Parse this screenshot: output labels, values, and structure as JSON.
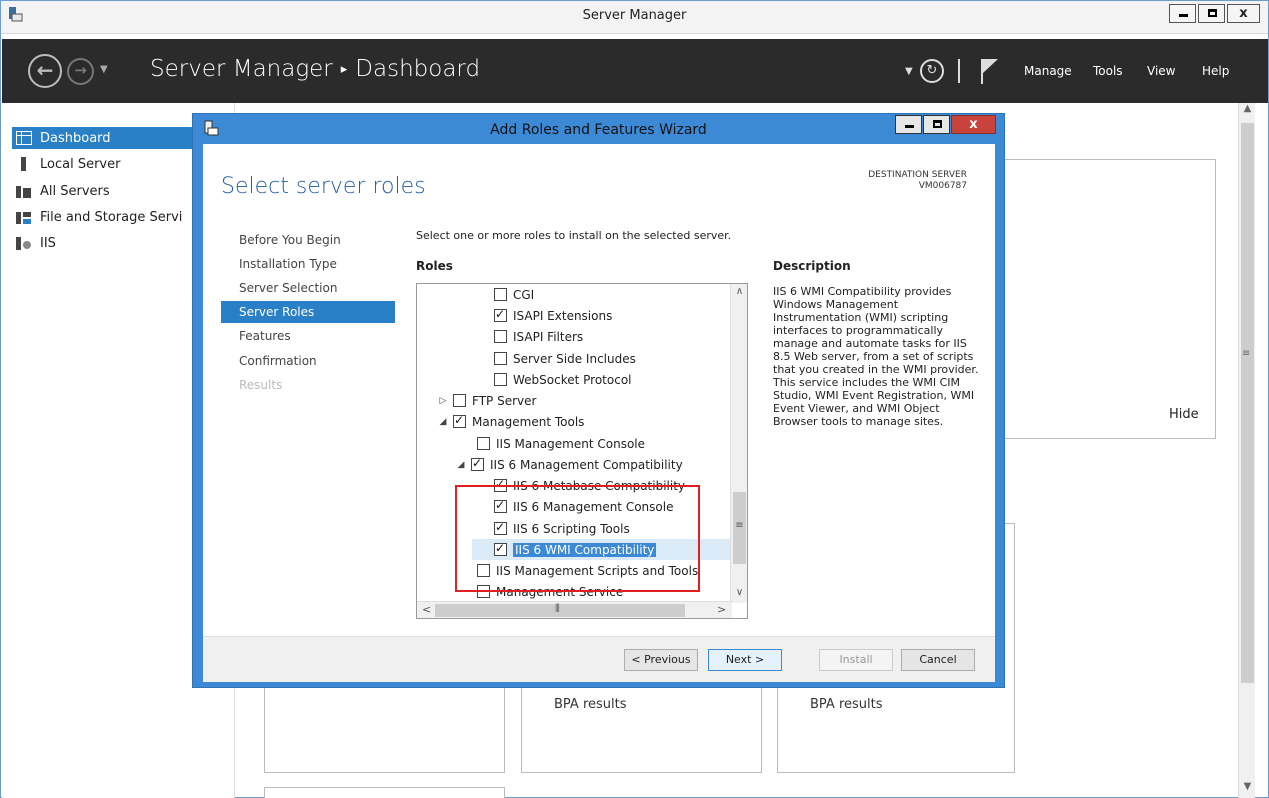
{
  "outer": {
    "title": "Server Manager",
    "minimize": "",
    "maximize": "",
    "close": "x"
  },
  "header": {
    "breadcrumb_app": "Server Manager",
    "breadcrumb_sep": "▸",
    "breadcrumb_page": "Dashboard",
    "menu": [
      "Manage",
      "Tools",
      "View",
      "Help"
    ]
  },
  "leftnav": {
    "items": [
      {
        "label": "Dashboard",
        "icon": "dashboard-icon"
      },
      {
        "label": "Local Server",
        "icon": "server-icon"
      },
      {
        "label": "All Servers",
        "icon": "servers-icon"
      },
      {
        "label": "File and Storage Servi",
        "icon": "storage-icon"
      },
      {
        "label": "IIS",
        "icon": "iis-icon"
      }
    ]
  },
  "background": {
    "hide_label": "Hide",
    "bpa1": "BPA results",
    "bpa2": "BPA results"
  },
  "wizard": {
    "title": "Add Roles and Features Wizard",
    "page_title": "Select server roles",
    "dest_label": "DESTINATION SERVER",
    "dest_server": "VM006787",
    "steps": [
      {
        "label": "Before You Begin",
        "state": "normal"
      },
      {
        "label": "Installation Type",
        "state": "normal"
      },
      {
        "label": "Server Selection",
        "state": "normal"
      },
      {
        "label": "Server Roles",
        "state": "active"
      },
      {
        "label": "Features",
        "state": "normal"
      },
      {
        "label": "Confirmation",
        "state": "normal"
      },
      {
        "label": "Results",
        "state": "disabled"
      }
    ],
    "intro": "Select one or more roles to install on the selected server.",
    "roles_heading": "Roles",
    "description_heading": "Description",
    "description": "IIS 6 WMI Compatibility provides Windows Management Instrumentation (WMI) scripting interfaces to programmatically manage and automate tasks for IIS 8.5 Web server, from a set of scripts that you created in the WMI provider. This service includes the WMI CIM Studio, WMI Event Registration, WMI Event Viewer, and WMI Object Browser tools to manage sites.",
    "tree": [
      {
        "label": "CGI",
        "checked": false,
        "expander": ""
      },
      {
        "label": "ISAPI Extensions",
        "checked": true,
        "expander": ""
      },
      {
        "label": "ISAPI Filters",
        "checked": false,
        "expander": ""
      },
      {
        "label": "Server Side Includes",
        "checked": false,
        "expander": ""
      },
      {
        "label": "WebSocket Protocol",
        "checked": false,
        "expander": ""
      },
      {
        "label": "FTP Server",
        "checked": false,
        "expander": "▷"
      },
      {
        "label": "Management Tools",
        "checked": true,
        "expander": "◢"
      },
      {
        "label": "IIS Management Console",
        "checked": false,
        "expander": ""
      },
      {
        "label": "IIS 6 Management Compatibility",
        "checked": true,
        "expander": "◢"
      },
      {
        "label": "IIS 6 Metabase Compatibility",
        "checked": true,
        "expander": ""
      },
      {
        "label": "IIS 6 Management Console",
        "checked": true,
        "expander": ""
      },
      {
        "label": "IIS 6 Scripting Tools",
        "checked": true,
        "expander": ""
      },
      {
        "label": "IIS 6 WMI Compatibility",
        "checked": true,
        "expander": "",
        "selected": true
      },
      {
        "label": "IIS Management Scripts and Tools",
        "checked": false,
        "expander": ""
      },
      {
        "label": "Management Service",
        "checked": false,
        "expander": ""
      }
    ],
    "buttons": {
      "previous": "< Previous",
      "next": "Next >",
      "install": "Install",
      "cancel": "Cancel"
    }
  },
  "colors": {
    "accent": "#2a80c6",
    "dialog_frame": "#3c8ad6",
    "highlight_box": "#e02020",
    "header_bg": "#2b2b2b"
  }
}
